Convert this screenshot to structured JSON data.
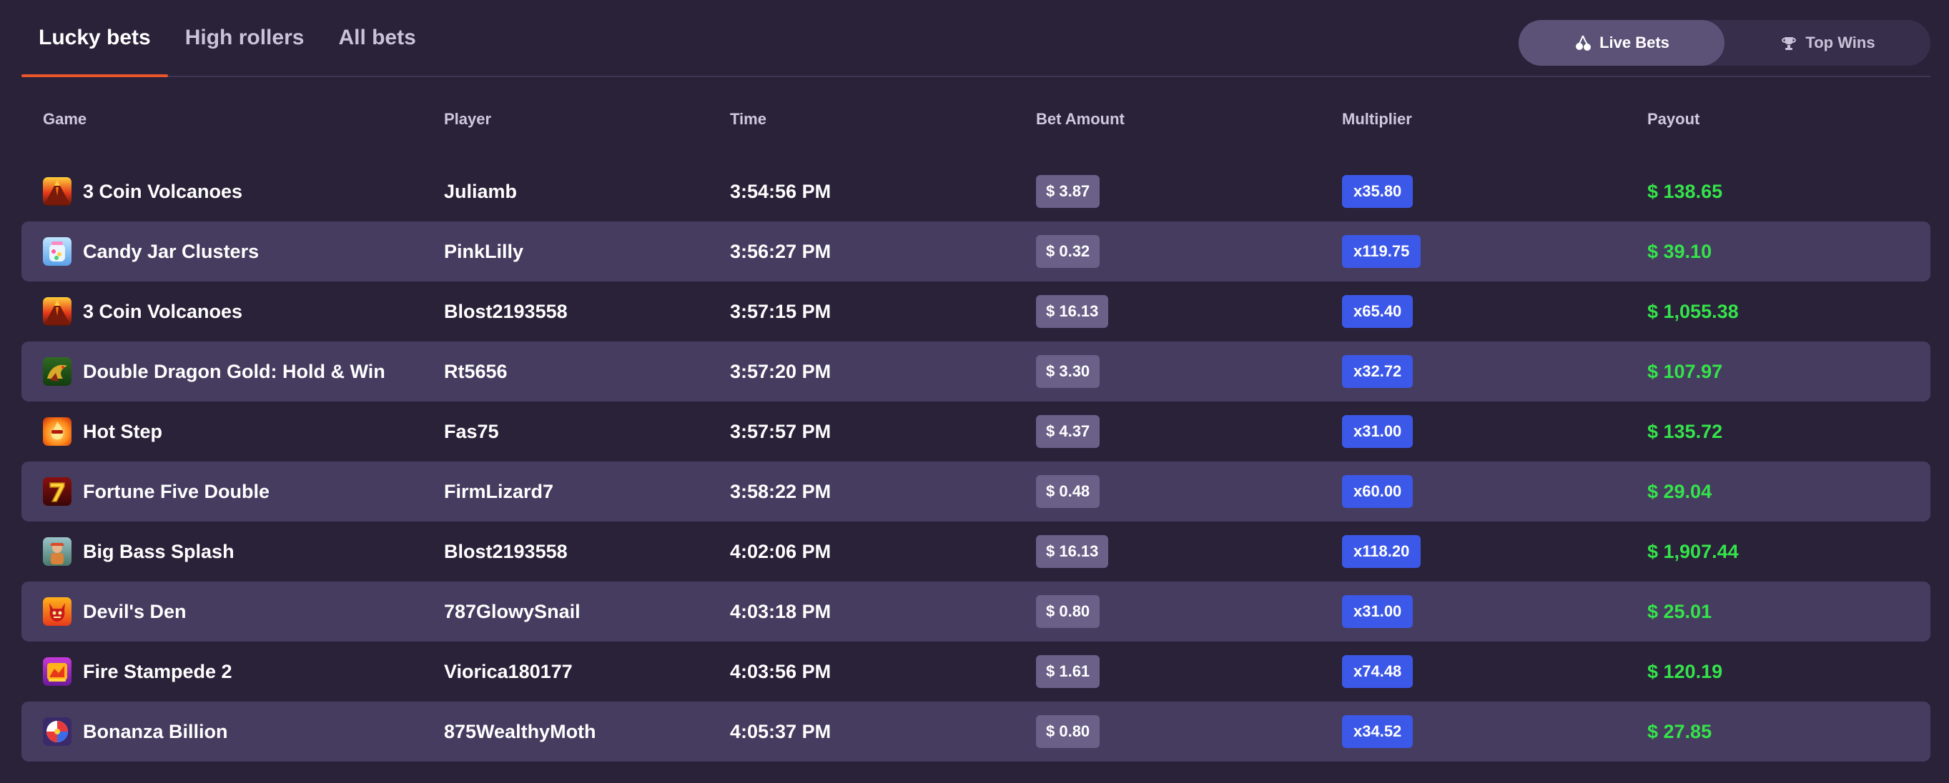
{
  "tabs": [
    {
      "label": "Lucky bets",
      "active": true
    },
    {
      "label": "High rollers",
      "active": false
    },
    {
      "label": "All bets",
      "active": false
    }
  ],
  "toggle": {
    "live_bets": "Live Bets",
    "top_wins": "Top Wins"
  },
  "colors": {
    "background": "#2a2239",
    "row_alt": "#463c5f",
    "accent_tab": "#e8562a",
    "multiplier": "#3c58e8",
    "payout": "#34e34a"
  },
  "table": {
    "headers": {
      "game": "Game",
      "player": "Player",
      "time": "Time",
      "bet": "Bet Amount",
      "multiplier": "Multiplier",
      "payout": "Payout"
    },
    "rows": [
      {
        "game": "3 Coin Volcanoes",
        "icon": "volcano-icon",
        "player": "Juliamb",
        "time": "3:54:56 PM",
        "bet": "$ 3.87",
        "multiplier": "x35.80",
        "payout": "$ 138.65"
      },
      {
        "game": "Candy Jar Clusters",
        "icon": "candy-jar-icon",
        "player": "PinkLilly",
        "time": "3:56:27 PM",
        "bet": "$ 0.32",
        "multiplier": "x119.75",
        "payout": "$ 39.10"
      },
      {
        "game": "3 Coin Volcanoes",
        "icon": "volcano-icon",
        "player": "Blost2193558",
        "time": "3:57:15 PM",
        "bet": "$ 16.13",
        "multiplier": "x65.40",
        "payout": "$ 1,055.38"
      },
      {
        "game": "Double Dragon Gold: Hold & Win",
        "icon": "dragon-icon",
        "player": "Rt5656",
        "time": "3:57:20 PM",
        "bet": "$ 3.30",
        "multiplier": "x32.72",
        "payout": "$ 107.97"
      },
      {
        "game": "Hot Step",
        "icon": "fire-icon",
        "player": "Fas75",
        "time": "3:57:57 PM",
        "bet": "$ 4.37",
        "multiplier": "x31.00",
        "payout": "$ 135.72"
      },
      {
        "game": "Fortune Five Double",
        "icon": "seven-icon",
        "player": "FirmLizard7",
        "time": "3:58:22 PM",
        "bet": "$ 0.48",
        "multiplier": "x60.00",
        "payout": "$ 29.04"
      },
      {
        "game": "Big Bass Splash",
        "icon": "fisherman-icon",
        "player": "Blost2193558",
        "time": "4:02:06 PM",
        "bet": "$ 16.13",
        "multiplier": "x118.20",
        "payout": "$ 1,907.44"
      },
      {
        "game": "Devil's Den",
        "icon": "devil-icon",
        "player": "787GlowySnail",
        "time": "4:03:18 PM",
        "bet": "$ 0.80",
        "multiplier": "x31.00",
        "payout": "$ 25.01"
      },
      {
        "game": "Fire Stampede 2",
        "icon": "stampede-icon",
        "player": "Viorica180177",
        "time": "4:03:56 PM",
        "bet": "$ 1.61",
        "multiplier": "x74.48",
        "payout": "$ 120.19"
      },
      {
        "game": "Bonanza Billion",
        "icon": "lollipop-icon",
        "player": "875WealthyMoth",
        "time": "4:05:37 PM",
        "bet": "$ 0.80",
        "multiplier": "x34.52",
        "payout": "$ 27.85"
      }
    ]
  }
}
